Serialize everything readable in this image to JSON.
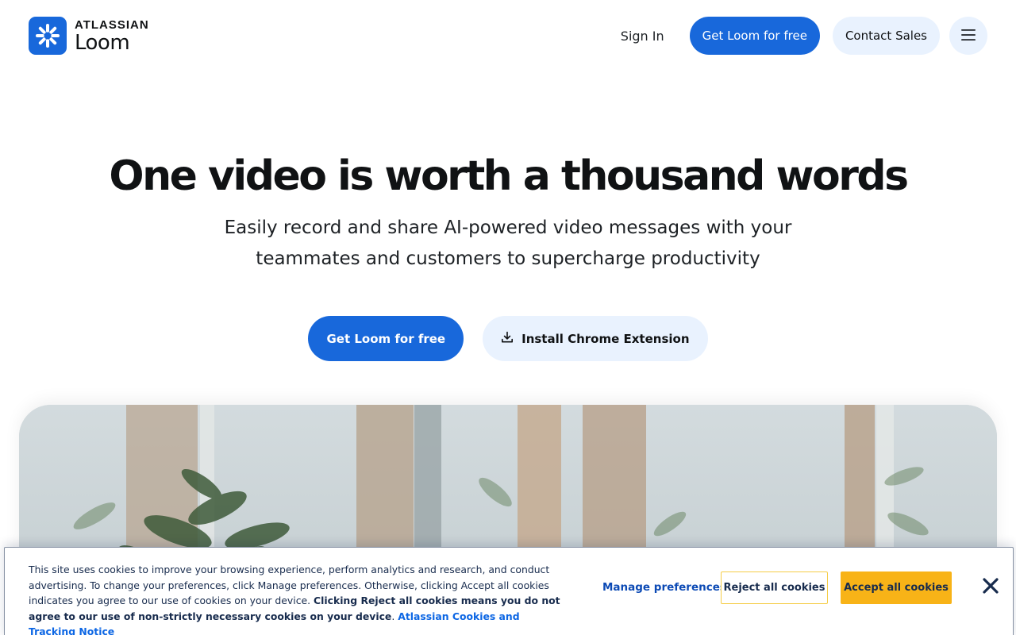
{
  "header": {
    "logo_brand": "ATLASSIAN",
    "logo_product": "Loom",
    "sign_in": "Sign In",
    "get_loom": "Get Loom for free",
    "contact_sales": "Contact Sales",
    "menu_icon": "hamburger-menu-icon"
  },
  "hero": {
    "title": "One video is worth a thousand words",
    "subtitle": "Easily record and share AI-powered video messages with your teammates and customers to supercharge productivity",
    "cta_primary": "Get Loom for free",
    "cta_secondary": "Install Chrome Extension",
    "cta_secondary_icon": "download-icon"
  },
  "cookie_banner": {
    "text_plain": "This site uses cookies to improve your browsing experience, perform analytics and research, and conduct advertising. To change your preferences, click Manage preferences. Otherwise, clicking Accept all cookies indicates you agree to our use of cookies on your device. ",
    "text_bold": "Clicking Reject all cookies means you do not agree to our use of non-strictly necessary cookies on your device",
    "text_period": ".",
    "link": "Atlassian Cookies and Tracking Notice",
    "manage": "Manage preferences",
    "reject": "Reject all cookies",
    "accept": "Accept all cookies",
    "close_icon": "close-icon"
  },
  "colors": {
    "primary": "#1868db",
    "soft": "#e9f2fe",
    "accept": "#f8b317",
    "reject_border": "#f5cd47"
  }
}
